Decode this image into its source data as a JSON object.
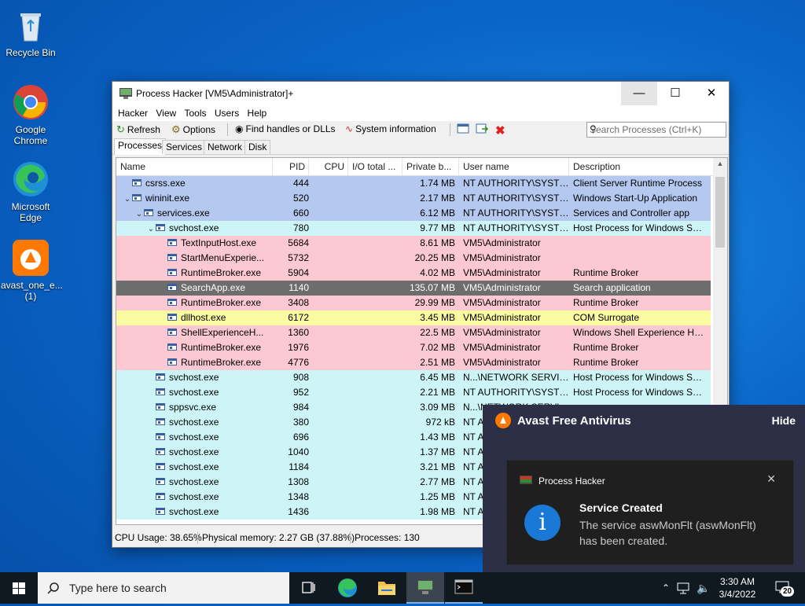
{
  "desktop": {
    "icons": [
      {
        "label": "Recycle Bin"
      },
      {
        "label": "Google Chrome"
      },
      {
        "label": "Microsoft Edge"
      },
      {
        "label": "avast_one_e...\n(1)"
      }
    ]
  },
  "window": {
    "title": "Process Hacker [VM5\\Administrator]+",
    "menu": [
      "Hacker",
      "View",
      "Tools",
      "Users",
      "Help"
    ],
    "toolbar": {
      "refresh": "Refresh",
      "options": "Options",
      "find": "Find handles or DLLs",
      "sysinfo": "System information"
    },
    "search_placeholder": "Search Processes (Ctrl+K)",
    "tabs": [
      "Processes",
      "Services",
      "Network",
      "Disk"
    ],
    "columns": [
      "Name",
      "PID",
      "CPU",
      "I/O total ...",
      "Private b...",
      "User name",
      "Description"
    ],
    "rows": [
      {
        "indent": 0,
        "tw": "",
        "name": "csrss.exe",
        "pid": "444",
        "priv": "1.74 MB",
        "user": "NT AUTHORITY\\SYSTEM",
        "desc": "Client Server Runtime Process",
        "color": "#b4c8f0"
      },
      {
        "indent": 0,
        "tw": "⌄",
        "name": "wininit.exe",
        "pid": "520",
        "priv": "2.17 MB",
        "user": "NT AUTHORITY\\SYSTEM",
        "desc": "Windows Start-Up Application",
        "color": "#b4c8f0"
      },
      {
        "indent": 1,
        "tw": "⌄",
        "name": "services.exe",
        "pid": "660",
        "priv": "6.12 MB",
        "user": "NT AUTHORITY\\SYSTEM",
        "desc": "Services and Controller app",
        "color": "#b4c8f0"
      },
      {
        "indent": 2,
        "tw": "⌄",
        "name": "svchost.exe",
        "pid": "780",
        "priv": "9.77 MB",
        "user": "NT AUTHORITY\\SYSTEM",
        "desc": "Host Process for Windows Ser...",
        "color": "#cdf5f8"
      },
      {
        "indent": 3,
        "tw": "",
        "name": "TextInputHost.exe",
        "pid": "5684",
        "priv": "8.61 MB",
        "user": "VM5\\Administrator",
        "desc": "",
        "color": "#fcc8d2"
      },
      {
        "indent": 3,
        "tw": "",
        "name": "StartMenuExperie...",
        "pid": "5732",
        "priv": "20.25 MB",
        "user": "VM5\\Administrator",
        "desc": "",
        "color": "#fcc8d2"
      },
      {
        "indent": 3,
        "tw": "",
        "name": "RuntimeBroker.exe",
        "pid": "5904",
        "priv": "4.02 MB",
        "user": "VM5\\Administrator",
        "desc": "Runtime Broker",
        "color": "#fcc8d2"
      },
      {
        "indent": 3,
        "tw": "",
        "name": "SearchApp.exe",
        "pid": "1140",
        "priv": "135.07 MB",
        "user": "VM5\\Administrator",
        "desc": "Search application",
        "color": "#6d6d6d"
      },
      {
        "indent": 3,
        "tw": "",
        "name": "RuntimeBroker.exe",
        "pid": "3408",
        "priv": "29.99 MB",
        "user": "VM5\\Administrator",
        "desc": "Runtime Broker",
        "color": "#fcc8d2"
      },
      {
        "indent": 3,
        "tw": "",
        "name": "dllhost.exe",
        "pid": "6172",
        "priv": "3.45 MB",
        "user": "VM5\\Administrator",
        "desc": "COM Surrogate",
        "color": "#fafaa0"
      },
      {
        "indent": 3,
        "tw": "",
        "name": "ShellExperienceH...",
        "pid": "1360",
        "priv": "22.5 MB",
        "user": "VM5\\Administrator",
        "desc": "Windows Shell Experience Host",
        "color": "#fcc8d2"
      },
      {
        "indent": 3,
        "tw": "",
        "name": "RuntimeBroker.exe",
        "pid": "1976",
        "priv": "7.02 MB",
        "user": "VM5\\Administrator",
        "desc": "Runtime Broker",
        "color": "#fcc8d2"
      },
      {
        "indent": 3,
        "tw": "",
        "name": "RuntimeBroker.exe",
        "pid": "4776",
        "priv": "2.51 MB",
        "user": "VM5\\Administrator",
        "desc": "Runtime Broker",
        "color": "#fcc8d2"
      },
      {
        "indent": 2,
        "tw": "",
        "name": "svchost.exe",
        "pid": "908",
        "priv": "6.45 MB",
        "user": "N...\\NETWORK SERVICE",
        "desc": "Host Process for Windows Ser...",
        "color": "#cdf5f8"
      },
      {
        "indent": 2,
        "tw": "",
        "name": "svchost.exe",
        "pid": "952",
        "priv": "2.21 MB",
        "user": "NT AUTHORITY\\SYSTEM",
        "desc": "Host Process for Windows Ser...",
        "color": "#cdf5f8"
      },
      {
        "indent": 2,
        "tw": "",
        "name": "sppsvc.exe",
        "pid": "984",
        "priv": "3.09 MB",
        "user": "N...\\NETWORK SERVICE",
        "desc": "",
        "color": "#cdf5f8"
      },
      {
        "indent": 2,
        "tw": "",
        "name": "svchost.exe",
        "pid": "380",
        "priv": "972 kB",
        "user": "NT A",
        "desc": "",
        "color": "#cdf5f8"
      },
      {
        "indent": 2,
        "tw": "",
        "name": "svchost.exe",
        "pid": "696",
        "priv": "1.43 MB",
        "user": "NT A",
        "desc": "",
        "color": "#cdf5f8"
      },
      {
        "indent": 2,
        "tw": "",
        "name": "svchost.exe",
        "pid": "1040",
        "priv": "1.37 MB",
        "user": "NT A",
        "desc": "",
        "color": "#cdf5f8"
      },
      {
        "indent": 2,
        "tw": "",
        "name": "svchost.exe",
        "pid": "1184",
        "priv": "3.21 MB",
        "user": "NT A",
        "desc": "",
        "color": "#cdf5f8"
      },
      {
        "indent": 2,
        "tw": "",
        "name": "svchost.exe",
        "pid": "1308",
        "priv": "2.77 MB",
        "user": "NT A",
        "desc": "",
        "color": "#cdf5f8"
      },
      {
        "indent": 2,
        "tw": "",
        "name": "svchost.exe",
        "pid": "1348",
        "priv": "1.25 MB",
        "user": "NT A",
        "desc": "",
        "color": "#cdf5f8"
      },
      {
        "indent": 2,
        "tw": "",
        "name": "svchost.exe",
        "pid": "1436",
        "priv": "1.98 MB",
        "user": "NT A",
        "desc": "",
        "color": "#cdf5f8"
      }
    ],
    "status": {
      "cpu": "CPU Usage: 38.65%",
      "mem": "Physical memory: 2.27 GB (37.88%)",
      "procs": "Processes: 130"
    }
  },
  "avast": {
    "title": "Avast Free Antivirus",
    "hide": "Hide"
  },
  "toast": {
    "app": "Process Hacker",
    "heading": "Service Created",
    "body": "The service aswMonFlt (aswMonFlt) has been created."
  },
  "taskbar": {
    "search_placeholder": "Type here to search",
    "time": "3:30 AM",
    "date": "3/4/2022",
    "notification_count": "20"
  }
}
